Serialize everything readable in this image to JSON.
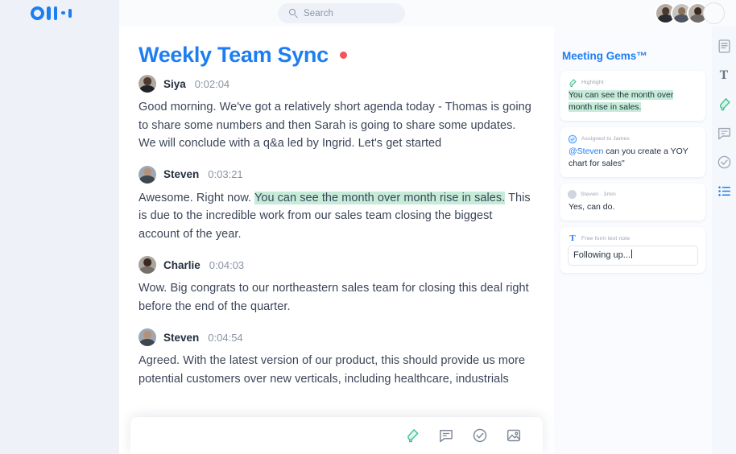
{
  "app": {
    "logo_name": "otter-logo"
  },
  "search": {
    "placeholder": "Search",
    "value": "",
    "icon": "search-icon"
  },
  "header": {
    "avatars": [
      "avatar-1",
      "avatar-2",
      "avatar-3",
      "avatar-add-empty"
    ]
  },
  "document": {
    "title": "Weekly Team Sync",
    "recording_indicator": "recording-dot",
    "blocks": [
      {
        "speaker": "Siya",
        "timestamp": "0:02:04",
        "text": "Good morning. We've got a relatively short agenda today - Thomas is going to share some numbers and then Sarah is going to share some updates. We will conclude with a q&a led by Ingrid. Let's get started"
      },
      {
        "speaker": "Steven",
        "timestamp": "0:03:21",
        "text_before": "Awesome. Right now. ",
        "text_highlight": "You can see the month over month rise in sales.",
        "text_after": " This is due to the incredible work from our sales team closing the biggest account of the year."
      },
      {
        "speaker": "Charlie",
        "timestamp": "0:04:03",
        "text": "Wow. Big congrats to our northeastern sales team for closing this deal right before the end of the quarter."
      },
      {
        "speaker": "Steven",
        "timestamp": "0:04:54",
        "text": "Agreed. With the latest version of our product, this should provide us more potential customers over new verticals, including healthcare, industrials"
      }
    ]
  },
  "bottom_toolbar": {
    "items": [
      "highlight-icon",
      "comment-icon",
      "action-item-icon",
      "image-icon"
    ]
  },
  "gems_panel": {
    "title": "Meeting Gems™",
    "cards": [
      {
        "type": "highlight",
        "icon": "gem-highlight-icon",
        "label": "Highlight",
        "text": "You can see the month over month rise in sales."
      },
      {
        "type": "action_item",
        "icon": "check-circle-icon",
        "label": "Assigned to James",
        "mention": "@Steven",
        "text": " can you create a YOY chart for sales\""
      },
      {
        "type": "comment",
        "icon": "commenter-avatar",
        "label": "Steven · 3min",
        "text": "Yes, can do."
      },
      {
        "type": "note",
        "icon": "text-note-icon",
        "label": "Free form text note",
        "text": "Following up..."
      }
    ]
  },
  "right_rail": {
    "items": [
      {
        "name": "document-outline-icon",
        "active": false
      },
      {
        "name": "text-format-icon",
        "active": false
      },
      {
        "name": "highlight-icon",
        "active": false
      },
      {
        "name": "comment-icon",
        "active": false
      },
      {
        "name": "action-item-icon",
        "active": false
      },
      {
        "name": "list-view-icon",
        "active": true
      }
    ]
  },
  "colors": {
    "brand_blue": "#1d7ef2",
    "highlight_green": "#c6ecd9",
    "gem_green": "#3fbf8f",
    "recording_red": "#f2555a",
    "text_dark": "#24303f",
    "text_muted": "#8a93a5",
    "page_bg": "#eef2f8"
  }
}
